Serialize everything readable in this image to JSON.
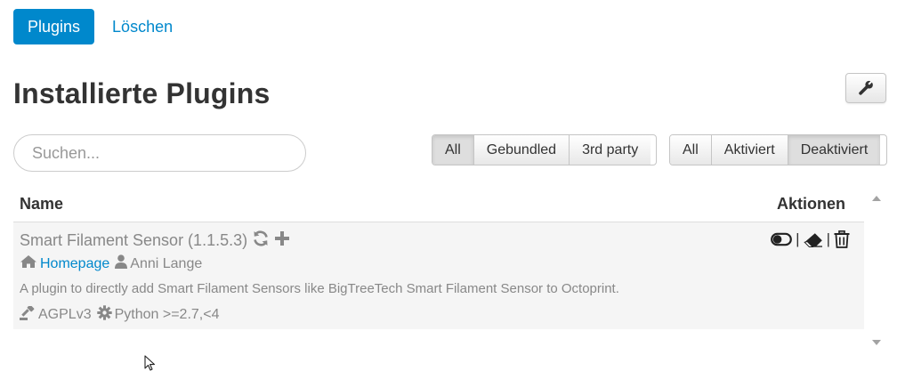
{
  "tabs": [
    {
      "label": "Plugins",
      "active": true
    },
    {
      "label": "Löschen",
      "active": false
    }
  ],
  "page_title": "Installierte Plugins",
  "toolbar": {
    "settings_icon": "wrench-icon"
  },
  "search": {
    "placeholder": "Suchen...",
    "value": ""
  },
  "filters": {
    "source": [
      "All",
      "Gebundled",
      "3rd party"
    ],
    "source_active": "All",
    "state": [
      "All",
      "Aktiviert",
      "Deaktiviert"
    ],
    "state_active": "Deaktiviert"
  },
  "table": {
    "headers": {
      "name": "Name",
      "actions": "Aktionen"
    },
    "rows": [
      {
        "title": "Smart Filament Sensor (1.1.5.3)",
        "homepage_label": "Homepage",
        "author": "Anni Lange",
        "description": "A plugin to directly add Smart Filament Sensors like BigTreeTech Smart Filament Sensor to Octoprint.",
        "license": "AGPLv3",
        "python": "Python >=2.7,<4",
        "separator": "|"
      }
    ]
  },
  "colors": {
    "accent": "#0088cc",
    "muted_text": "#888888",
    "row_bg": "#f5f5f5"
  }
}
